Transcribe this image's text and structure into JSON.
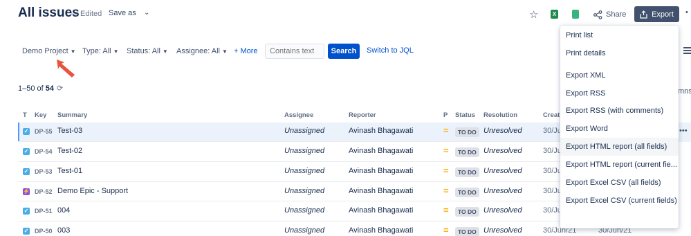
{
  "header": {
    "title": "All issues",
    "edited": "— Edited",
    "save_as": "Save as",
    "share": "Share",
    "export": "Export"
  },
  "filters": {
    "project": "Demo Project",
    "type": "Type: All",
    "status": "Status: All",
    "assignee": "Assignee: All",
    "more": "+ More",
    "search_placeholder": "Contains text",
    "search_button": "Search",
    "switch_jql": "Switch to JQL"
  },
  "count": {
    "range": "1–50",
    "of": "of",
    "total": "54"
  },
  "table": {
    "headers": [
      "T",
      "Key",
      "Summary",
      "Assignee",
      "Reporter",
      "P",
      "Status",
      "Resolution",
      "Creat"
    ],
    "rows": [
      {
        "type": "task",
        "key": "DP-55",
        "summary": "Test-03",
        "assignee": "Unassigned",
        "reporter": "Avinash Bhagawati",
        "status": "TO DO",
        "resolution": "Unresolved",
        "created": "30/Jun/",
        "updated": ""
      },
      {
        "type": "task",
        "key": "DP-54",
        "summary": "Test-02",
        "assignee": "Unassigned",
        "reporter": "Avinash Bhagawati",
        "status": "TO DO",
        "resolution": "Unresolved",
        "created": "30/Jun/",
        "updated": ""
      },
      {
        "type": "task",
        "key": "DP-53",
        "summary": "Test-01",
        "assignee": "Unassigned",
        "reporter": "Avinash Bhagawati",
        "status": "TO DO",
        "resolution": "Unresolved",
        "created": "30/Jun/",
        "updated": ""
      },
      {
        "type": "epic",
        "key": "DP-52",
        "summary": "Demo Epic - Support",
        "assignee": "Unassigned",
        "reporter": "Avinash Bhagawati",
        "status": "TO DO",
        "resolution": "Unresolved",
        "created": "30/Jun/",
        "updated": ""
      },
      {
        "type": "task",
        "key": "DP-51",
        "summary": "004",
        "assignee": "Unassigned",
        "reporter": "Avinash Bhagawati",
        "status": "TO DO",
        "resolution": "Unresolved",
        "created": "30/Jun/21",
        "updated": "30/Jun/21"
      },
      {
        "type": "task",
        "key": "DP-50",
        "summary": "003",
        "assignee": "Unassigned",
        "reporter": "Avinash Bhagawati",
        "status": "TO DO",
        "resolution": "Unresolved",
        "created": "30/Jun/21",
        "updated": "30/Jun/21"
      }
    ]
  },
  "columns_peek": "mns",
  "export_menu": {
    "items": [
      "Print list",
      "Print details",
      "Export XML",
      "Export RSS",
      "Export RSS (with comments)",
      "Export Word",
      "Export HTML report (all fields)",
      "Export HTML report (current fie...",
      "Export Excel CSV (all fields)",
      "Export Excel CSV (current fields)"
    ],
    "highlighted": "Export HTML report (all fields)"
  },
  "colors": {
    "primary": "#0052cc",
    "export_button": "#42526e",
    "task_icon": "#4bade8",
    "epic_icon": "#904ee2",
    "priority": "#ffab00",
    "annotation_arrow": "#e8553e"
  },
  "icons": [
    "star-icon",
    "excel-icon",
    "document-icon",
    "share-icon",
    "export-icon",
    "refresh-icon",
    "hamburger-icon"
  ]
}
